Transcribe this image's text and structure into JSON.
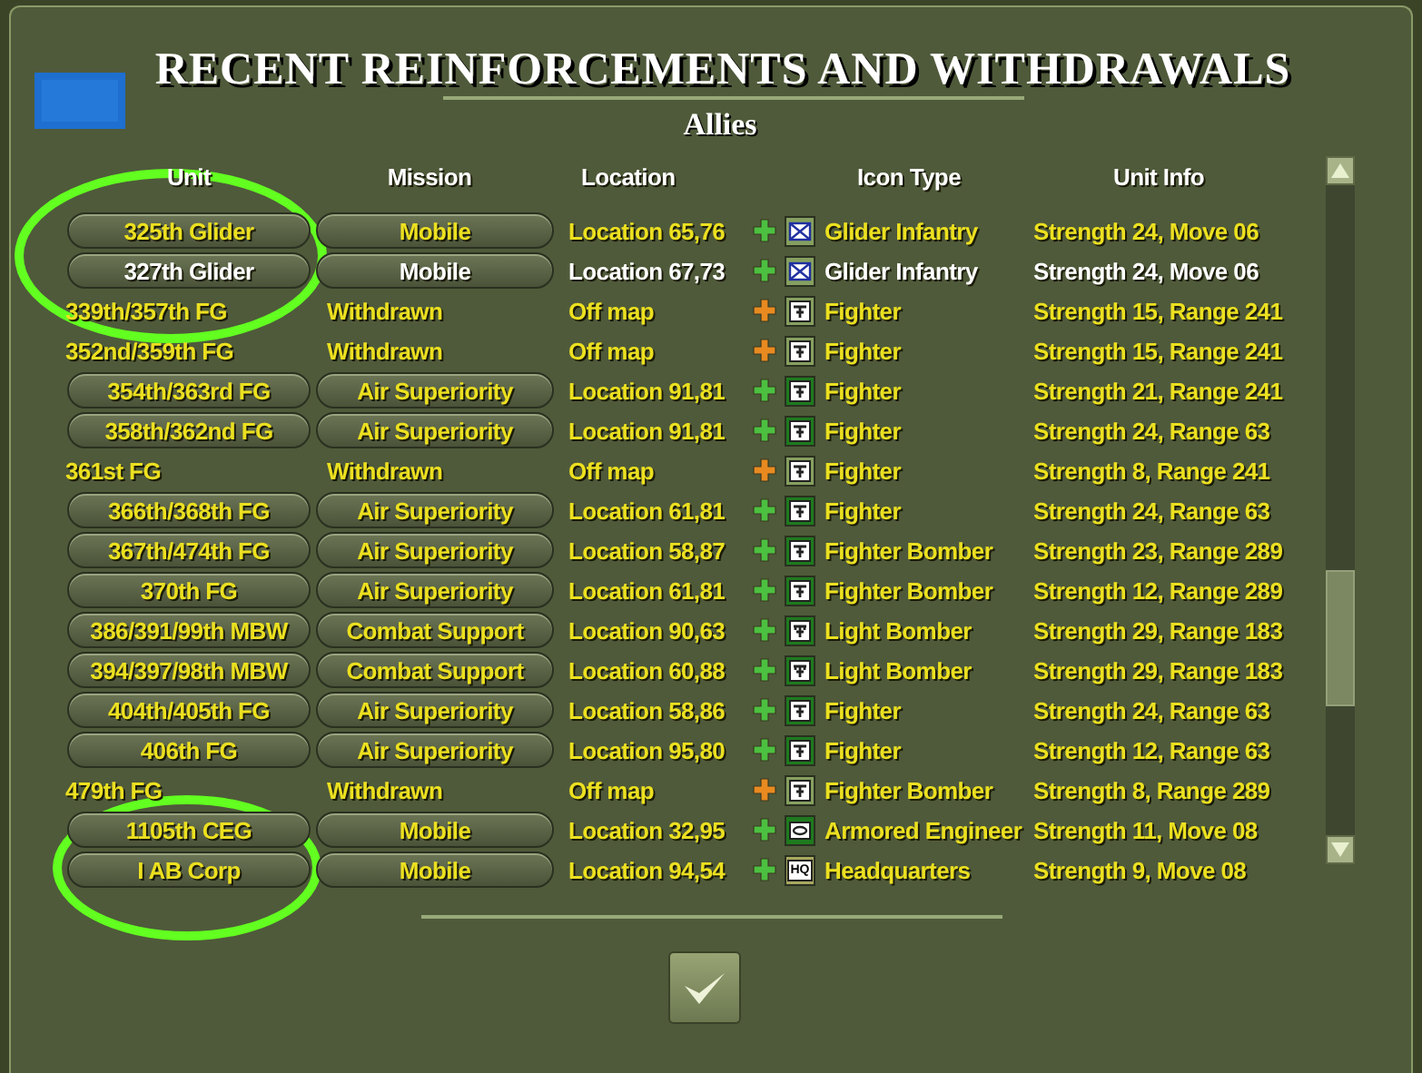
{
  "dialog": {
    "title": "RECENT REINFORCEMENTS AND WITHDRAWALS",
    "side": "Allies"
  },
  "columns": [
    "Unit",
    "Mission",
    "Location",
    "Icon Type",
    "Unit Info"
  ],
  "rows": [
    {
      "kind": "active",
      "selected": false,
      "withdrawn": false,
      "unit": "325th Glider",
      "mission": "Mobile",
      "location": "Location 65,76",
      "tile": {
        "kind": "glider",
        "pale": true
      },
      "icon_type": "Glider Infantry",
      "info": "Strength 24, Move 06"
    },
    {
      "kind": "active",
      "selected": true,
      "withdrawn": false,
      "unit": "327th Glider",
      "mission": "Mobile",
      "location": "Location 67,73",
      "tile": {
        "kind": "glider",
        "pale": true
      },
      "icon_type": "Glider Infantry",
      "info": "Strength 24, Move 06"
    },
    {
      "kind": "withdrawn",
      "selected": false,
      "withdrawn": true,
      "unit": "339th/357th FG",
      "mission": "Withdrawn",
      "location": "Off map",
      "tile": {
        "kind": "fighter",
        "pale": true
      },
      "icon_type": "Fighter",
      "info": "Strength 15, Range 241"
    },
    {
      "kind": "withdrawn",
      "selected": false,
      "withdrawn": true,
      "unit": "352nd/359th FG",
      "mission": "Withdrawn",
      "location": "Off map",
      "tile": {
        "kind": "fighter",
        "pale": true
      },
      "icon_type": "Fighter",
      "info": "Strength 15, Range 241"
    },
    {
      "kind": "active",
      "selected": false,
      "withdrawn": false,
      "unit": "354th/363rd FG",
      "mission": "Air Superiority",
      "location": "Location 91,81",
      "tile": {
        "kind": "fighter",
        "pale": false
      },
      "icon_type": "Fighter",
      "info": "Strength 21, Range 241"
    },
    {
      "kind": "active",
      "selected": false,
      "withdrawn": false,
      "unit": "358th/362nd FG",
      "mission": "Air Superiority",
      "location": "Location 91,81",
      "tile": {
        "kind": "fighter",
        "pale": false
      },
      "icon_type": "Fighter",
      "info": "Strength 24, Range 63"
    },
    {
      "kind": "withdrawn",
      "selected": false,
      "withdrawn": true,
      "unit": "361st FG",
      "mission": "Withdrawn",
      "location": "Off map",
      "tile": {
        "kind": "fighter",
        "pale": true
      },
      "icon_type": "Fighter",
      "info": "Strength 8, Range 241"
    },
    {
      "kind": "active",
      "selected": false,
      "withdrawn": false,
      "unit": "366th/368th FG",
      "mission": "Air Superiority",
      "location": "Location 61,81",
      "tile": {
        "kind": "fighter",
        "pale": false
      },
      "icon_type": "Fighter",
      "info": "Strength 24, Range 63"
    },
    {
      "kind": "active",
      "selected": false,
      "withdrawn": false,
      "unit": "367th/474th FG",
      "mission": "Air Superiority",
      "location": "Location 58,87",
      "tile": {
        "kind": "fighter",
        "pale": false
      },
      "icon_type": "Fighter Bomber",
      "info": "Strength 23, Range 289"
    },
    {
      "kind": "active",
      "selected": false,
      "withdrawn": false,
      "unit": "370th FG",
      "mission": "Air Superiority",
      "location": "Location 61,81",
      "tile": {
        "kind": "fighter",
        "pale": false
      },
      "icon_type": "Fighter Bomber",
      "info": "Strength 12, Range 289"
    },
    {
      "kind": "active",
      "selected": false,
      "withdrawn": false,
      "unit": "386/391/99th MBW",
      "mission": "Combat Support",
      "location": "Location 90,63",
      "tile": {
        "kind": "bomber",
        "pale": false
      },
      "icon_type": "Light Bomber",
      "info": "Strength 29, Range 183"
    },
    {
      "kind": "active",
      "selected": false,
      "withdrawn": false,
      "unit": "394/397/98th MBW",
      "mission": "Combat Support",
      "location": "Location 60,88",
      "tile": {
        "kind": "bomber",
        "pale": false
      },
      "icon_type": "Light Bomber",
      "info": "Strength 29, Range 183"
    },
    {
      "kind": "active",
      "selected": false,
      "withdrawn": false,
      "unit": "404th/405th FG",
      "mission": "Air Superiority",
      "location": "Location 58,86",
      "tile": {
        "kind": "fighter",
        "pale": false
      },
      "icon_type": "Fighter",
      "info": "Strength 24, Range 63"
    },
    {
      "kind": "active",
      "selected": false,
      "withdrawn": false,
      "unit": "406th FG",
      "mission": "Air Superiority",
      "location": "Location 95,80",
      "tile": {
        "kind": "fighter",
        "pale": false
      },
      "icon_type": "Fighter",
      "info": "Strength 12, Range 63"
    },
    {
      "kind": "withdrawn",
      "selected": false,
      "withdrawn": true,
      "unit": "479th FG",
      "mission": "Withdrawn",
      "location": "Off map",
      "tile": {
        "kind": "fighter",
        "pale": true
      },
      "icon_type": "Fighter Bomber",
      "info": "Strength 8, Range 289"
    },
    {
      "kind": "active",
      "selected": false,
      "withdrawn": false,
      "unit": "1105th CEG",
      "mission": "Mobile",
      "location": "Location 32,95",
      "tile": {
        "kind": "armor",
        "pale": false
      },
      "icon_type": "Armored Engineer",
      "info": "Strength 11, Move 08"
    },
    {
      "kind": "active",
      "selected": false,
      "withdrawn": false,
      "unit": "I AB Corp",
      "mission": "Mobile",
      "location": "Location 94,54",
      "tile": {
        "kind": "hq",
        "pale": true,
        "label": "HQ"
      },
      "icon_type": "Headquarters",
      "info": "Strength 9, Move 08"
    }
  ],
  "annotations": [
    {
      "kind": "ellipse"
    },
    {
      "kind": "ellipse"
    }
  ]
}
